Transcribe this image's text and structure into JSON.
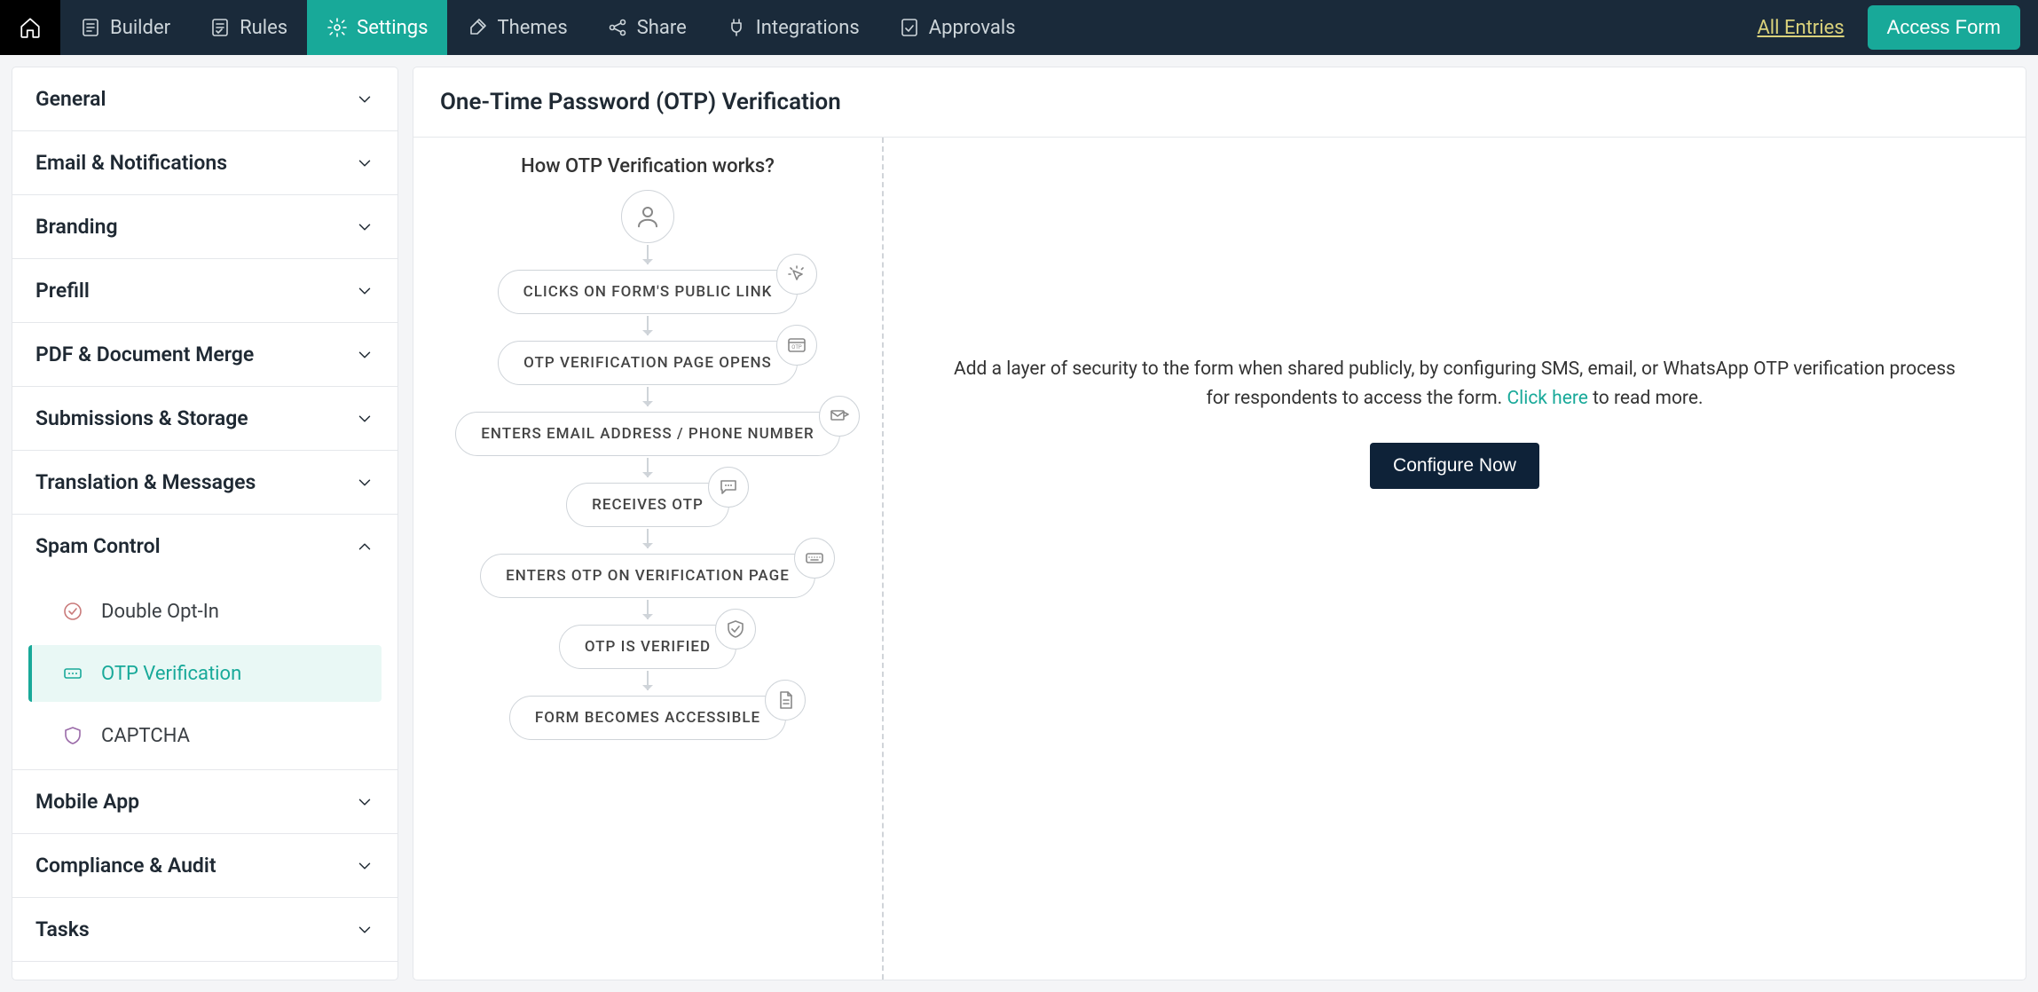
{
  "topnav": {
    "tabs": [
      {
        "label": "Builder",
        "icon": "form-icon"
      },
      {
        "label": "Rules",
        "icon": "rules-icon"
      },
      {
        "label": "Settings",
        "icon": "gear-icon",
        "active": true
      },
      {
        "label": "Themes",
        "icon": "paint-icon"
      },
      {
        "label": "Share",
        "icon": "share-icon"
      },
      {
        "label": "Integrations",
        "icon": "plug-icon"
      },
      {
        "label": "Approvals",
        "icon": "approval-icon"
      }
    ],
    "all_entries": "All Entries",
    "access_form": "Access Form"
  },
  "sidebar": {
    "sections": [
      {
        "label": "General",
        "expanded": false
      },
      {
        "label": "Email & Notifications",
        "expanded": false
      },
      {
        "label": "Branding",
        "expanded": false
      },
      {
        "label": "Prefill",
        "expanded": false
      },
      {
        "label": "PDF & Document Merge",
        "expanded": false
      },
      {
        "label": "Submissions & Storage",
        "expanded": false
      },
      {
        "label": "Translation & Messages",
        "expanded": false
      },
      {
        "label": "Spam Control",
        "expanded": true,
        "items": [
          {
            "label": "Double Opt-In",
            "icon": "check-circle-icon"
          },
          {
            "label": "OTP Verification",
            "icon": "keypad-icon",
            "active": true
          },
          {
            "label": "CAPTCHA",
            "icon": "shield-icon"
          }
        ]
      },
      {
        "label": "Mobile App",
        "expanded": false
      },
      {
        "label": "Compliance & Audit",
        "expanded": false
      },
      {
        "label": "Tasks",
        "expanded": false
      }
    ]
  },
  "page": {
    "title": "One-Time Password (OTP) Verification",
    "flow_title": "How OTP Verification works?",
    "flow_steps": [
      "CLICKS ON FORM'S PUBLIC LINK",
      "OTP VERIFICATION PAGE OPENS",
      "ENTERS EMAIL ADDRESS / PHONE NUMBER",
      "RECEIVES OTP",
      "ENTERS OTP ON VERIFICATION PAGE",
      "OTP IS VERIFIED",
      "FORM BECOMES ACCESSIBLE"
    ],
    "info_prefix": "Add a layer of security to the form when shared publicly, by configuring SMS, email, or WhatsApp OTP verification process for respondents to access the form. ",
    "info_link": "Click here",
    "info_suffix": " to read more.",
    "configure": "Configure Now"
  }
}
